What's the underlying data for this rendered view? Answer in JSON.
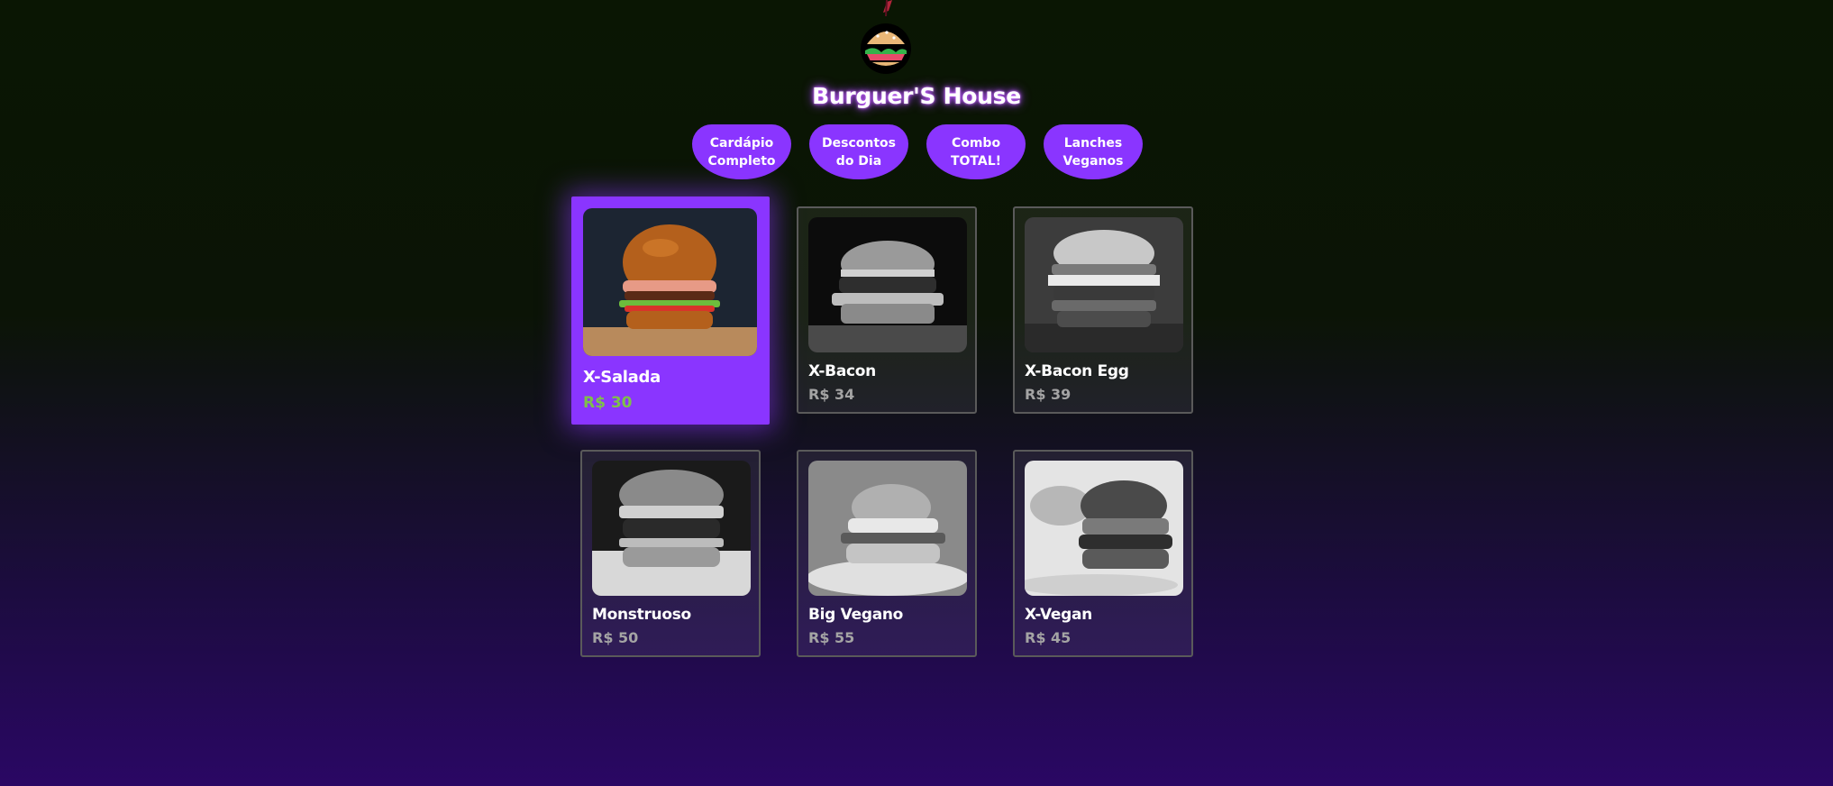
{
  "header": {
    "title": "Burguer'S House",
    "logo_icon": "burger-logo-icon"
  },
  "nav": {
    "items": [
      {
        "label": "Cardápio\nCompleto"
      },
      {
        "label": "Descontos\ndo Dia"
      },
      {
        "label": "Combo\nTOTAL!"
      },
      {
        "label": "Lanches\nVeganos"
      }
    ]
  },
  "products": [
    {
      "name": "X-Salada",
      "price": "R$ 30",
      "featured": true
    },
    {
      "name": "X-Bacon",
      "price": "R$ 34"
    },
    {
      "name": "X-Bacon Egg",
      "price": "R$ 39"
    },
    {
      "name": "Monstruoso",
      "price": "R$ 50"
    },
    {
      "name": "Big Vegano",
      "price": "R$ 55"
    },
    {
      "name": "X-Vegan",
      "price": "R$ 45"
    }
  ],
  "colors": {
    "accent": "#8a35ff",
    "featured_price": "#7ec04a",
    "price": "#a4a4a4"
  }
}
